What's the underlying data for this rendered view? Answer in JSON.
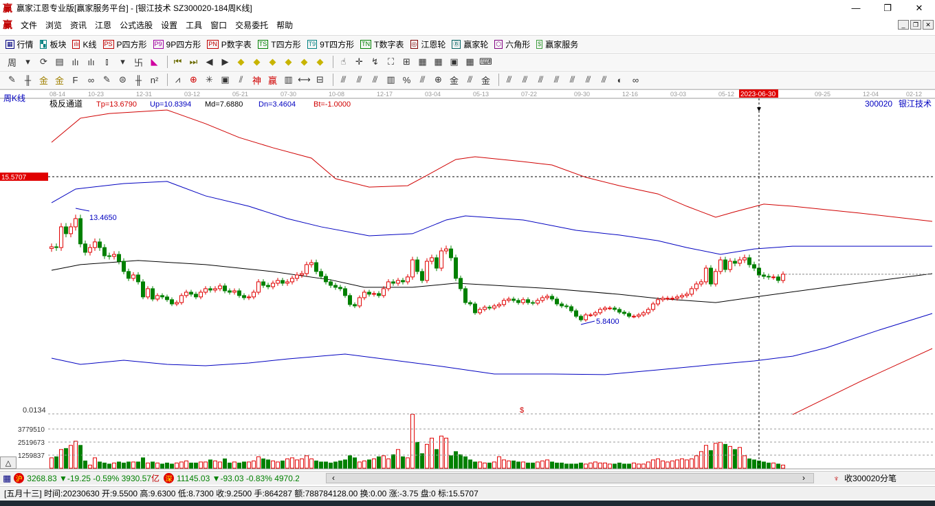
{
  "window": {
    "logo": "赢",
    "title": "赢家江恩专业版[赢家服务平台] - [银江技术  SZ300020-184周K线]",
    "min": "—",
    "max": "❐",
    "close": "✕"
  },
  "menu": {
    "logo": "赢",
    "items": [
      "文件",
      "浏览",
      "资讯",
      "江恩",
      "公式选股",
      "设置",
      "工具",
      "窗口",
      "交易委托",
      "帮助"
    ],
    "mdi": [
      "_",
      "❐",
      "✕"
    ]
  },
  "toolbar1": [
    {
      "icon": "▦",
      "label": "行情",
      "color": "#000080"
    },
    {
      "icon": "▚",
      "label": "板块",
      "color": "#008080"
    },
    {
      "icon": "ılı",
      "label": "K线",
      "color": "#c00000"
    },
    {
      "icon": "PS",
      "label": "P四方形",
      "color": "#c00000"
    },
    {
      "icon": "P9",
      "label": "9P四方形",
      "color": "#a000a0"
    },
    {
      "icon": "PN",
      "label": "P数字表",
      "color": "#c00000"
    },
    {
      "icon": "TS",
      "label": "T四方形",
      "color": "#008000"
    },
    {
      "icon": "T9",
      "label": "9T四方形",
      "color": "#008080"
    },
    {
      "icon": "TN",
      "label": "T数字表",
      "color": "#008000"
    },
    {
      "icon": "◎",
      "label": "江恩轮",
      "color": "#800000"
    },
    {
      "icon": "Ⓑ",
      "label": "赢家轮",
      "color": "#006060"
    },
    {
      "icon": "⬡",
      "label": "六角形",
      "color": "#800080"
    },
    {
      "icon": "$",
      "label": "赢家服务",
      "color": "#3c9c3c"
    }
  ],
  "toolbar2": [
    "周",
    "▾",
    "⟳",
    "▤",
    "ılı",
    "ılı",
    "⫾",
    "▾",
    "卐",
    "◣",
    "⏮",
    "⏭",
    "◀",
    "▶",
    "◆",
    "◆",
    "◆",
    "◆",
    "◆",
    "◆",
    "☝",
    "✛",
    "↯",
    "⛶",
    "⊞",
    "▦",
    "▦",
    "▣",
    "▦",
    "⌨"
  ],
  "toolbar3": [
    "✎",
    "╫",
    "金",
    "金",
    "F",
    "∞",
    "✎",
    "⊜",
    "╫",
    "n²",
    "⩘",
    "⊕",
    "✳",
    "▣",
    "⫽",
    "神",
    "赢",
    "▥",
    "⟷",
    "⊟",
    "⫻",
    "⫻",
    "⫻",
    "▥",
    "%",
    "⫻",
    "⊕",
    "金",
    "⫻",
    "金",
    "⫻",
    "⫻",
    "⫻",
    "⫻",
    "⫻",
    "⫻",
    "⫻",
    "◐",
    "∞"
  ],
  "chart_header": {
    "period": "周K线",
    "indicator": "极反通道",
    "tp": "Tp=13.6790",
    "up": "Up=10.8394",
    "md": "Md=7.6880",
    "dn": "Dn=3.4604",
    "bt": "Bt=-1.0000",
    "stock_code": "300020",
    "stock_name": "银江技术",
    "cursor_price": "15.5707",
    "cursor_date": "2023-06-30",
    "high_label": "13.4650",
    "low_label": "5.8400",
    "marker": "$"
  },
  "colors": {
    "up": "#e00000",
    "down": "#008000",
    "tp": "#d00000",
    "band": "#0000c0",
    "md": "#000000",
    "bt": "#d00000"
  },
  "chart_data": {
    "type": "candlestick",
    "title": "SZ300020-184周K线",
    "ylim": [
      0,
      20.6
    ],
    "x_ticks": [
      {
        "i": 1,
        "label": "08-14"
      },
      {
        "i": 9,
        "label": "10-23"
      },
      {
        "i": 19,
        "label": "12-31"
      },
      {
        "i": 29,
        "label": "03-12"
      },
      {
        "i": 39,
        "label": "05-21"
      },
      {
        "i": 49,
        "label": "07-30"
      },
      {
        "i": 59,
        "label": "10-08"
      },
      {
        "i": 69,
        "label": "12-17"
      },
      {
        "i": 79,
        "label": "03-04"
      },
      {
        "i": 89,
        "label": "05-13"
      },
      {
        "i": 99,
        "label": "07-22"
      },
      {
        "i": 110,
        "label": "09-30"
      },
      {
        "i": 120,
        "label": "12-16"
      },
      {
        "i": 130,
        "label": "03-03"
      },
      {
        "i": 140,
        "label": "05-12"
      },
      {
        "i": 160,
        "label": "09-25"
      },
      {
        "i": 170,
        "label": "12-04"
      },
      {
        "i": 179,
        "label": "02-12"
      }
    ],
    "cursor_index": 147,
    "close": [
      10.94,
      10.89,
      12.25,
      11.8,
      12.25,
      12.79,
      11.13,
      10.58,
      10.89,
      11.26,
      10.89,
      10.35,
      10.31,
      10.44,
      9.99,
      9.32,
      8.87,
      9.09,
      8.64,
      7.65,
      8.19,
      7.51,
      7.74,
      7.65,
      7.47,
      7.19,
      7.28,
      7.74,
      7.96,
      7.83,
      7.65,
      7.96,
      8.19,
      8.1,
      8.19,
      8.37,
      8.05,
      7.96,
      8.05,
      7.74,
      7.6,
      7.65,
      7.96,
      8.64,
      8.41,
      8.32,
      8.55,
      8.73,
      8.55,
      8.64,
      8.87,
      9.09,
      9.18,
      9.77,
      9.9,
      9.32,
      9.0,
      8.64,
      8.41,
      8.28,
      8.19,
      7.74,
      7.15,
      7.06,
      7.6,
      7.96,
      7.83,
      7.87,
      7.74,
      8.19,
      8.64,
      8.55,
      8.73,
      8.64,
      8.96,
      10.08,
      9.32,
      8.73,
      9.99,
      10.22,
      9.54,
      10.67,
      10.8,
      10.22,
      8.87,
      8.19,
      7.28,
      7.19,
      6.61,
      6.83,
      6.97,
      6.92,
      7.06,
      7.15,
      7.42,
      7.51,
      7.42,
      7.28,
      7.47,
      7.28,
      7.24,
      7.42,
      7.6,
      7.69,
      7.51,
      7.19,
      7.06,
      7.01,
      6.74,
      6.38,
      6.15,
      6.47,
      6.47,
      6.61,
      6.83,
      6.92,
      6.92,
      6.83,
      6.65,
      6.56,
      6.38,
      6.38,
      6.47,
      6.61,
      6.83,
      7.19,
      7.47,
      7.56,
      7.56,
      7.56,
      7.65,
      7.74,
      7.83,
      8.19,
      8.5,
      8.64,
      9.54,
      8.5,
      9.32,
      10.08,
      9.45,
      9.99,
      9.86,
      10.08,
      10.22,
      9.77,
      9.54,
      9.09,
      9.0,
      8.96,
      8.96,
      8.73,
      9.14
    ],
    "volume_millions": [
      1.0,
      1.1,
      1.8,
      1.9,
      2.2,
      2.6,
      2.2,
      0.7,
      0.3,
      1.0,
      0.6,
      0.5,
      0.4,
      0.5,
      0.6,
      0.5,
      0.6,
      0.6,
      0.6,
      1.0,
      0.5,
      0.6,
      0.5,
      0.4,
      0.5,
      0.4,
      0.5,
      0.6,
      0.7,
      0.5,
      0.5,
      0.6,
      0.6,
      0.8,
      0.7,
      0.6,
      0.9,
      0.5,
      0.6,
      0.5,
      0.6,
      0.6,
      0.7,
      1.1,
      0.9,
      0.8,
      0.7,
      0.6,
      0.7,
      0.9,
      1.0,
      0.8,
      0.9,
      1.2,
      0.9,
      0.7,
      0.6,
      0.6,
      0.5,
      0.6,
      0.7,
      0.8,
      1.2,
      1.0,
      0.6,
      0.7,
      0.8,
      0.9,
      1.1,
      1.2,
      0.9,
      1.3,
      1.8,
      1.1,
      1.0,
      5.2,
      2.5,
      1.4,
      2.3,
      2.9,
      1.8,
      3.1,
      2.9,
      1.2,
      1.6,
      1.3,
      1.1,
      0.8,
      0.6,
      0.6,
      0.5,
      0.5,
      0.6,
      1.1,
      0.8,
      0.7,
      0.7,
      0.6,
      0.6,
      0.5,
      0.5,
      0.6,
      0.7,
      0.8,
      0.6,
      0.5,
      0.5,
      0.4,
      0.4,
      0.4,
      0.5,
      0.4,
      0.5,
      0.6,
      0.5,
      0.5,
      0.4,
      0.4,
      0.5,
      0.4,
      0.4,
      0.5,
      0.4,
      0.4,
      0.6,
      0.8,
      0.9,
      0.7,
      0.6,
      0.7,
      0.8,
      0.9,
      0.8,
      0.9,
      1.2,
      1.6,
      2.2,
      1.7,
      2.4,
      2.5,
      2.3,
      2.1,
      1.8,
      2.0,
      1.2,
      0.9,
      0.8,
      0.7,
      0.6,
      0.5,
      0.5,
      0.4,
      0.3
    ],
    "volume_ticks": [
      {
        "v": 1.259837,
        "label": "1259837"
      },
      {
        "v": 2.519673,
        "label": "2519673"
      },
      {
        "v": 3.77951,
        "label": "3779510"
      }
    ],
    "volume_top_label": "0.0134",
    "lines": [
      {
        "name": "Tp",
        "i": [
          0,
          6,
          12,
          24,
          32,
          39,
          46,
          54,
          59,
          66,
          74,
          78,
          84,
          88,
          98,
          104,
          111,
          118,
          126,
          132,
          138,
          142,
          148,
          154,
          168,
          183
        ],
        "p": [
          17.8,
          19.38,
          19.69,
          19.92,
          19.02,
          18.11,
          17.44,
          16.76,
          15.41,
          14.86,
          14.95,
          15.63,
          16.67,
          16.85,
          16.53,
          16.31,
          15.5,
          14.95,
          14.41,
          13.6,
          12.88,
          13.24,
          13.74,
          13.6,
          13.15,
          12.61
        ]
      },
      {
        "name": "Up",
        "i": [
          0,
          5,
          15,
          24,
          32,
          41,
          49,
          56,
          66,
          75,
          82,
          86,
          98,
          109,
          118,
          126,
          132,
          139,
          146,
          154,
          183
        ],
        "p": [
          13.83,
          14.73,
          15.09,
          15.23,
          14.28,
          13.6,
          12.79,
          12.25,
          11.66,
          11.8,
          12.7,
          12.97,
          12.7,
          12.02,
          11.71,
          11.34,
          10.89,
          10.44,
          10.8,
          10.98,
          10.98
        ]
      },
      {
        "name": "Md",
        "i": [
          0,
          6,
          18,
          32,
          46,
          58,
          65,
          75,
          84,
          92,
          104,
          118,
          126,
          138,
          146,
          161,
          183
        ],
        "p": [
          9.4,
          9.77,
          10.04,
          9.77,
          9.31,
          8.77,
          8.28,
          8.28,
          8.55,
          8.41,
          8.19,
          7.82,
          7.55,
          7.28,
          7.64,
          8.28,
          9.18
        ]
      },
      {
        "name": "Dn",
        "i": [
          0,
          6,
          15,
          24,
          32,
          41,
          49,
          61,
          69,
          81,
          92,
          104,
          115,
          126,
          138,
          146,
          154,
          161,
          172,
          183
        ],
        "p": [
          3.63,
          3.22,
          3.49,
          3.22,
          3.13,
          3.31,
          3.58,
          3.9,
          3.58,
          3.09,
          2.59,
          2.59,
          2.55,
          2.86,
          3.22,
          3.45,
          3.76,
          4.31,
          5.48,
          6.56
        ]
      },
      {
        "name": "Bt",
        "i": [
          154,
          168,
          183
        ],
        "p": [
          -0.07,
          2.09,
          4.26
        ]
      }
    ]
  },
  "index_bar": {
    "sh_badge": "沪",
    "sh": "3268.83 ▼-19.25 -0.59% 3930.57",
    "sh_unit": "亿",
    "sz_badge": "深",
    "sz": "11145.03 ▼-93.03 -0.83% 4970.20",
    "scroll_left": "‹",
    "scroll_right": "›",
    "tick_label": "收300020分笔"
  },
  "status": {
    "text": "[五月十三] 时间:20230630 开:9.5500 高:9.6300 低:8.7300 收:9.2500 手:864287 额:788784128.00 换:0.00 涨:-3.75 盘:0 标:15.5707"
  },
  "collapse_button": "△"
}
